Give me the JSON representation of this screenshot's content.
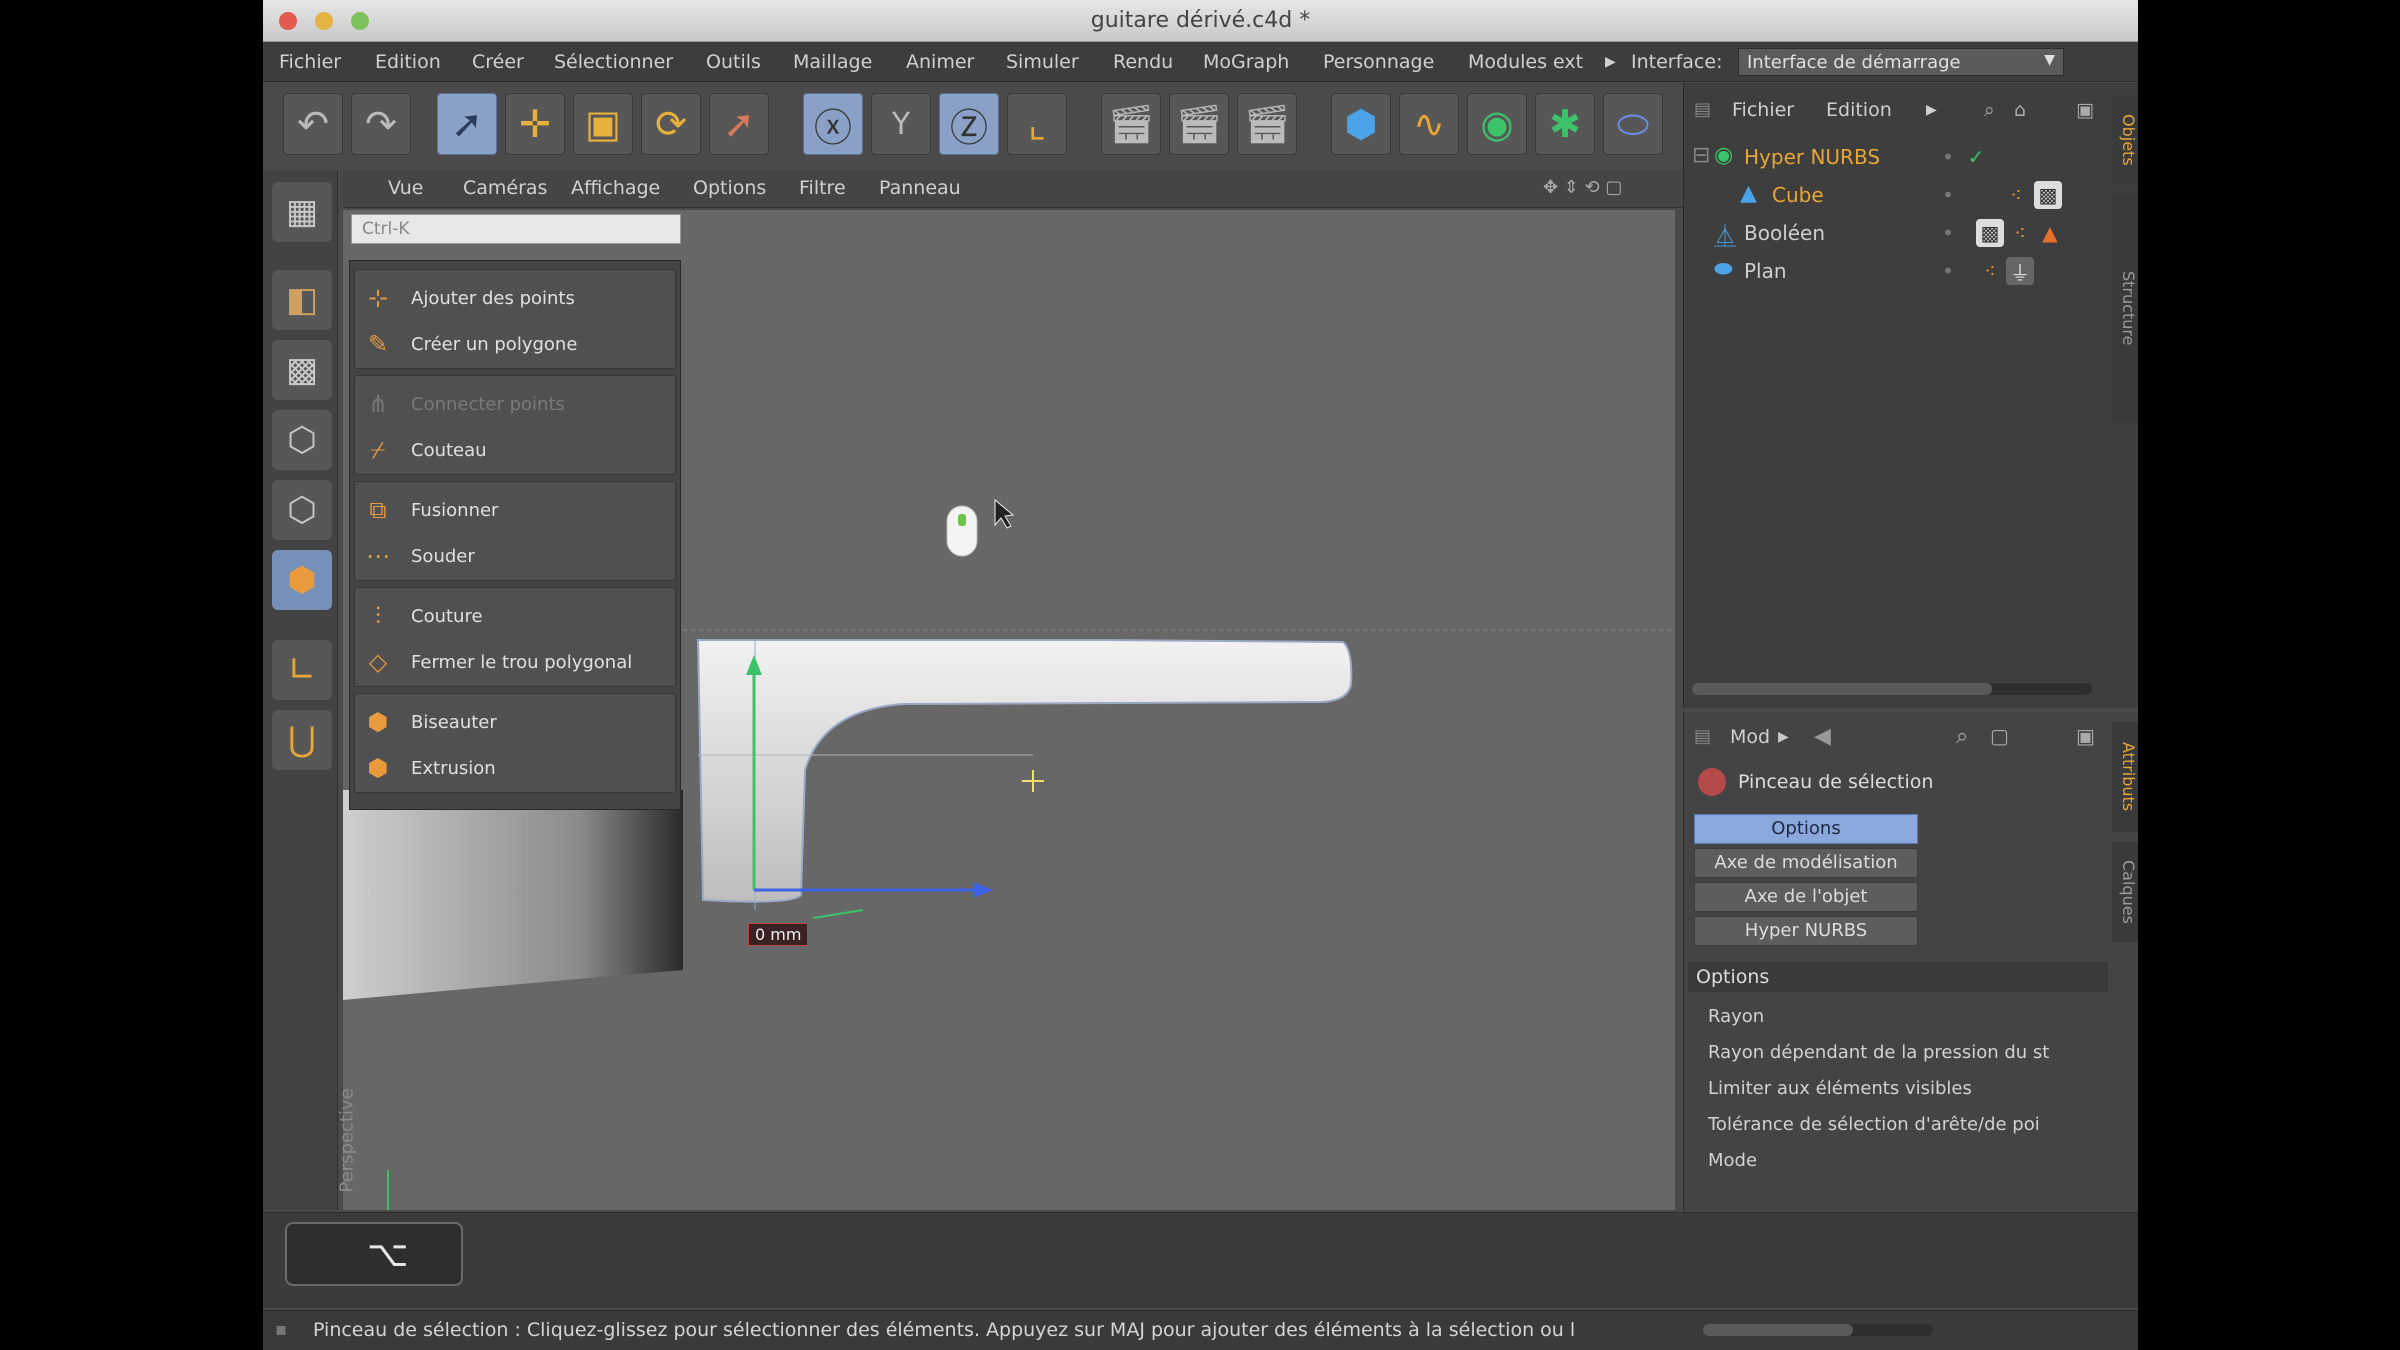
{
  "window": {
    "title": "guitare dérivé.c4d *"
  },
  "menu": [
    "Fichier",
    "Edition",
    "Créer",
    "Sélectionner",
    "Outils",
    "Maillage",
    "Animer",
    "Simuler",
    "Rendu",
    "MoGraph",
    "Personnage",
    "Modules ext",
    "Interface:"
  ],
  "interface_value": "Interface de démarrage",
  "viewport_menu": [
    "Vue",
    "Caméras",
    "Affichage",
    "Options",
    "Filtre",
    "Panneau"
  ],
  "search_placeholder": "Ctrl-K",
  "popup": {
    "items": [
      "Ajouter des points",
      "Créer un polygone",
      "Connecter points",
      "Couteau",
      "Fusionner",
      "Souder",
      "Couture",
      "Fermer le trou polygonal",
      "Biseauter",
      "Extrusion"
    ]
  },
  "viewport": {
    "measure": "0 mm",
    "axis_label": "Perspective"
  },
  "object_manager": {
    "menu": [
      "Fichier",
      "Edition"
    ],
    "objects": [
      "Hyper NURBS",
      "Cube",
      "Booléen",
      "Plan"
    ],
    "side_tab": "Objets",
    "side_tab2": "Structure"
  },
  "attributes": {
    "menu": "Mod",
    "tool_name": "Pinceau de sélection",
    "tabs": [
      "Options",
      "Axe de modélisation",
      "Axe de l'objet",
      "Hyper NURBS"
    ],
    "section": "Options",
    "options": [
      "Rayon",
      "Rayon dépendant de la pression du st",
      "Limiter aux éléments visibles",
      "Tolérance de sélection d'arête/de poi",
      "Mode"
    ],
    "side_tab": "Attributs",
    "side_tab2": "Calques"
  },
  "keyhint": "⌥",
  "status": "Pinceau de sélection : Cliquez-glissez pour sélectionner des éléments. Appuyez sur MAJ pour ajouter des éléments à la sélection ou l",
  "colors": {
    "accent": "#8aa8dc",
    "icon": "#e89a3c",
    "selected_text": "#e8a634"
  }
}
